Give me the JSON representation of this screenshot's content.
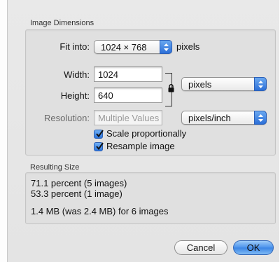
{
  "image_dimensions": {
    "section_title": "Image Dimensions",
    "fit_into": {
      "label": "Fit into:",
      "value": "1024 × 768",
      "unit": "pixels"
    },
    "width": {
      "label": "Width:",
      "value": "1024"
    },
    "height": {
      "label": "Height:",
      "value": "640"
    },
    "size_unit": "pixels",
    "resolution": {
      "label": "Resolution:",
      "placeholder": "Multiple Values",
      "unit": "pixels/inch"
    },
    "scale_proportionally": {
      "label": "Scale proportionally",
      "checked": true
    },
    "resample_image": {
      "label": "Resample image",
      "checked": true
    }
  },
  "resulting_size": {
    "section_title": "Resulting Size",
    "line1": "71.1 percent (5 images)",
    "line2": "53.3 percent (1 image)",
    "line3": "1.4 MB (was 2.4 MB) for 6 images"
  },
  "buttons": {
    "cancel": "Cancel",
    "ok": "OK"
  },
  "icons": {
    "lock": "lock-icon",
    "popup_arrows": "updown-arrows-icon",
    "checkmark": "checkmark-icon"
  }
}
